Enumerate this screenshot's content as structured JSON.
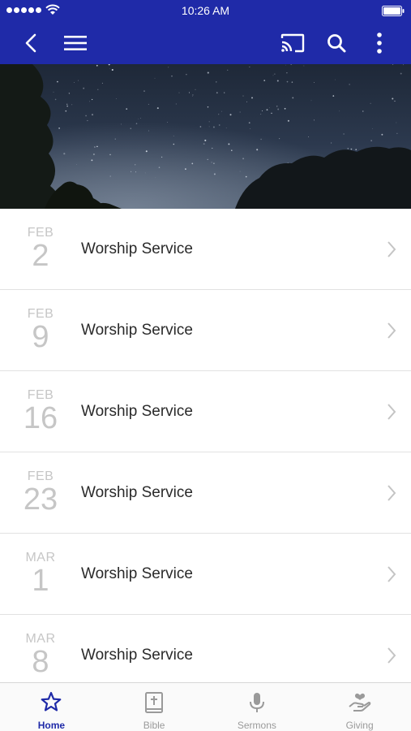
{
  "status_bar": {
    "time": "10:26 AM"
  },
  "colors": {
    "brand": "#1f2aa8",
    "date_gray": "#c6c6c6",
    "tab_inactive": "#9a9a9a"
  },
  "app_bar": {
    "icons": [
      "back-arrow-icon",
      "hamburger-menu-icon",
      "cast-icon",
      "search-icon",
      "more-vertical-icon"
    ]
  },
  "events": [
    {
      "month": "FEB",
      "day": "2",
      "title": "Worship Service"
    },
    {
      "month": "FEB",
      "day": "9",
      "title": "Worship Service"
    },
    {
      "month": "FEB",
      "day": "16",
      "title": "Worship Service"
    },
    {
      "month": "FEB",
      "day": "23",
      "title": "Worship Service"
    },
    {
      "month": "MAR",
      "day": "1",
      "title": "Worship Service"
    },
    {
      "month": "MAR",
      "day": "8",
      "title": "Worship Service"
    }
  ],
  "tabs": [
    {
      "label": "Home",
      "icon": "star-icon",
      "active": true
    },
    {
      "label": "Bible",
      "icon": "bible-icon",
      "active": false
    },
    {
      "label": "Sermons",
      "icon": "microphone-icon",
      "active": false
    },
    {
      "label": "Giving",
      "icon": "giving-hand-icon",
      "active": false
    }
  ]
}
